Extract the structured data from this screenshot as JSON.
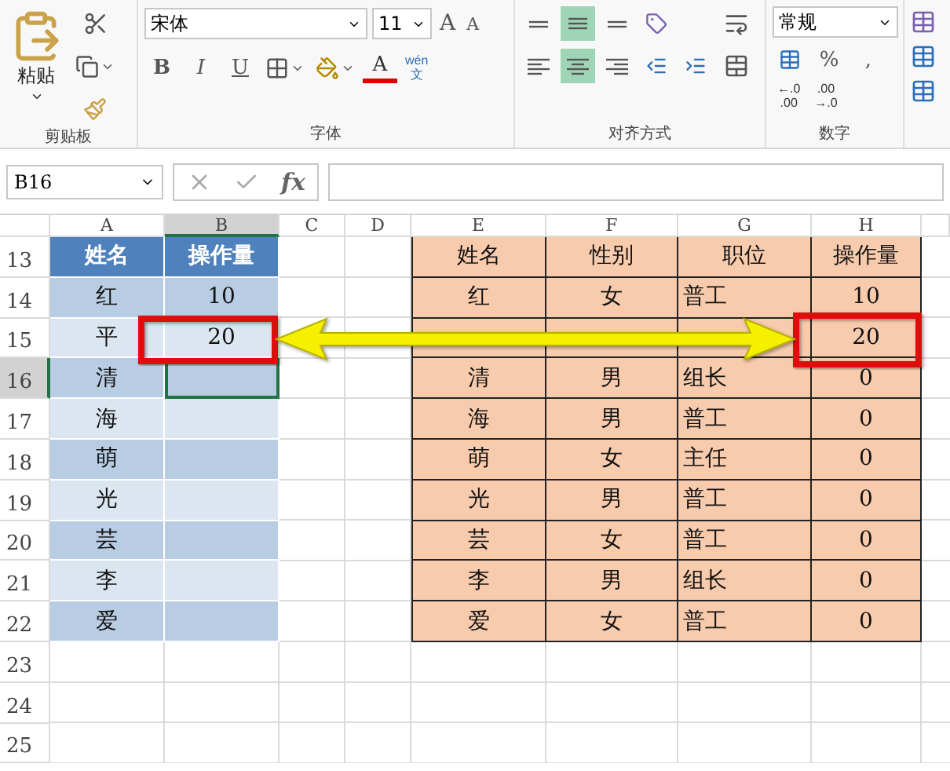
{
  "ribbon": {
    "clipboard": {
      "paste_label": "粘贴",
      "group_label": "剪贴板"
    },
    "font": {
      "family": "宋体",
      "size": "11",
      "grow": "A",
      "shrink": "A",
      "bold": "B",
      "italic": "I",
      "underline": "U",
      "font_color": "A",
      "phonetic_top": "wén",
      "phonetic_bottom": "文",
      "group_label": "字体"
    },
    "alignment": {
      "top_row": [
        {
          "kind": "top",
          "selected": false
        },
        {
          "kind": "middle",
          "selected": true
        },
        {
          "kind": "bottom",
          "selected": false
        }
      ],
      "bottom_row": [
        {
          "kind": "left",
          "selected": false
        },
        {
          "kind": "center",
          "selected": true
        },
        {
          "kind": "right",
          "selected": false
        }
      ],
      "group_label": "对齐方式"
    },
    "number": {
      "format": "常规",
      "percent": "%",
      "comma": ",",
      "decimals": [
        {
          "top": "←.0",
          "bottom": ".00"
        },
        {
          "top": ".00",
          "bottom": "→.0"
        }
      ],
      "group_label": "数字"
    }
  },
  "formula_bar": {
    "name_box": "B16",
    "function": "fx"
  },
  "columns": [
    {
      "label": "A",
      "selected": false
    },
    {
      "label": "B",
      "selected": true
    },
    {
      "label": "C",
      "selected": false
    },
    {
      "label": "D",
      "selected": false
    },
    {
      "label": "E",
      "selected": false
    },
    {
      "label": "F",
      "selected": false
    },
    {
      "label": "G",
      "selected": false
    },
    {
      "label": "H",
      "selected": false
    }
  ],
  "rows": [
    {
      "label": "13",
      "selected": false
    },
    {
      "label": "14",
      "selected": false
    },
    {
      "label": "15",
      "selected": false
    },
    {
      "label": "16",
      "selected": true
    },
    {
      "label": "17",
      "selected": false
    },
    {
      "label": "18",
      "selected": false
    },
    {
      "label": "19",
      "selected": false
    },
    {
      "label": "20",
      "selected": false
    },
    {
      "label": "21",
      "selected": false
    },
    {
      "label": "22",
      "selected": false
    },
    {
      "label": "23",
      "selected": false
    },
    {
      "label": "24",
      "selected": false
    },
    {
      "label": "25",
      "selected": false
    }
  ],
  "left_table": {
    "columns": [
      "姓名",
      "操作量"
    ],
    "rows": [
      {
        "name": "红",
        "amount": "10"
      },
      {
        "name": "平",
        "amount": "20"
      },
      {
        "name": "清"
      },
      {
        "name": "海"
      },
      {
        "name": "萌"
      },
      {
        "name": "光"
      },
      {
        "name": "芸"
      },
      {
        "name": "李"
      },
      {
        "name": "爱"
      }
    ]
  },
  "right_table": {
    "columns": [
      "姓名",
      "性别",
      "职位",
      "操作量"
    ],
    "rows": [
      {
        "name": "红",
        "gender": "女",
        "position": "普工",
        "amount": "10"
      },
      {
        "amount": "20"
      },
      {
        "name": "清",
        "gender": "男",
        "position": "组长",
        "amount": "0"
      },
      {
        "name": "海",
        "gender": "男",
        "position": "普工",
        "amount": "0"
      },
      {
        "name": "萌",
        "gender": "女",
        "position": "主任",
        "amount": "0"
      },
      {
        "name": "光",
        "gender": "男",
        "position": "普工",
        "amount": "0"
      },
      {
        "name": "芸",
        "gender": "女",
        "position": "普工",
        "amount": "0"
      },
      {
        "name": "李",
        "gender": "男",
        "position": "组长",
        "amount": "0"
      },
      {
        "name": "爱",
        "gender": "女",
        "position": "普工",
        "amount": "0"
      }
    ]
  }
}
